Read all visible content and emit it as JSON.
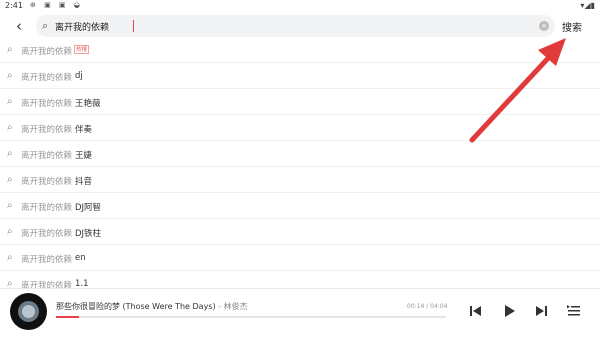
{
  "status": {
    "time": "2:41",
    "icons": "⊕ ▣ ▣ ◒",
    "right": "▾◢▮"
  },
  "search": {
    "value": "离开我的依赖",
    "button_label": "搜索"
  },
  "suggestions": [
    {
      "base": "离开我的依赖",
      "suffix": "",
      "badge": "热搜"
    },
    {
      "base": "离开我的依赖",
      "suffix": "dj",
      "badge": ""
    },
    {
      "base": "离开我的依赖",
      "suffix": "王艳薇",
      "badge": ""
    },
    {
      "base": "离开我的依赖",
      "suffix": "伴奏",
      "badge": ""
    },
    {
      "base": "离开我的依赖",
      "suffix": "王婕",
      "badge": ""
    },
    {
      "base": "离开我的依赖",
      "suffix": "抖音",
      "badge": ""
    },
    {
      "base": "离开我的依赖",
      "suffix": " DJ阿智",
      "badge": ""
    },
    {
      "base": "离开我的依赖",
      "suffix": " DJ铁柱",
      "badge": ""
    },
    {
      "base": "离开我的依赖",
      "suffix": " en",
      "badge": ""
    },
    {
      "base": "离开我的依赖",
      "suffix": "1.1",
      "badge": ""
    }
  ],
  "player": {
    "title": "那些你很冒险的梦 (Those Were The Days)",
    "separator": " - ",
    "artist": "林俊杰",
    "time": "00:14 / 04:04",
    "progress": 0.06
  },
  "colors": {
    "accent": "#e8424c",
    "annotation_arrow": "#e03a3a"
  }
}
